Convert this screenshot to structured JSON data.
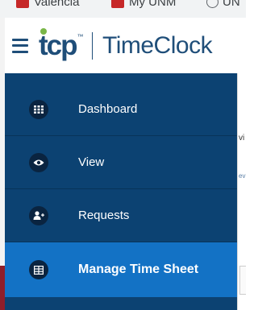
{
  "browser": {
    "bookmarks": [
      {
        "label": "Valencia",
        "icon": "unm-logo-icon"
      },
      {
        "label": "My UNM",
        "icon": "unm-logo-icon"
      },
      {
        "label": "UN",
        "icon": "globe-icon"
      }
    ]
  },
  "header": {
    "logo_text": "tcp",
    "logo_trademark": "™",
    "product_name": "TimeClock"
  },
  "sidebar": {
    "items": [
      {
        "label": "Dashboard",
        "icon": "grid-icon",
        "active": false
      },
      {
        "label": "View",
        "icon": "eye-icon",
        "active": false
      },
      {
        "label": "Requests",
        "icon": "user-plus-icon",
        "active": false
      },
      {
        "label": "Manage Time Sheet",
        "icon": "table-icon",
        "active": true
      }
    ]
  },
  "content": {
    "peek_text_1": "vi",
    "peek_text_2": "ev"
  },
  "colors": {
    "brand": "#1f4e79",
    "sidebar_bg": "#0c4272",
    "active_bg": "#1372c5",
    "accent_green": "#7ab648"
  }
}
